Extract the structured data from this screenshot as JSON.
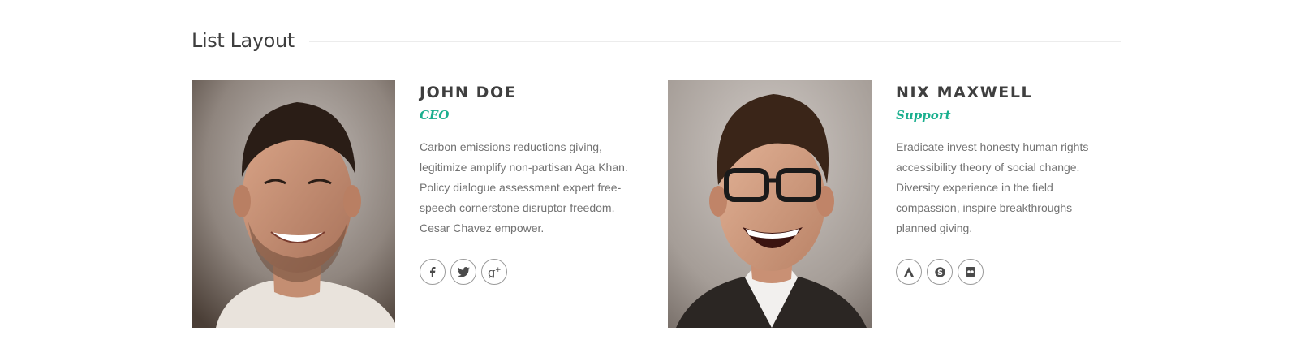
{
  "section": {
    "title": "List Layout"
  },
  "team": [
    {
      "name": "JOHN DOE",
      "role": "CEO",
      "bio": "Carbon emissions reductions giving, legitimize amplify non-partisan Aga Khan. Policy dialogue assessment expert free-speech cornerstone disruptor freedom. Cesar Chavez empower.",
      "socials": [
        "facebook-icon",
        "twitter-icon",
        "google-plus-icon"
      ]
    },
    {
      "name": "NIX MAXWELL",
      "role": "Support",
      "bio": "Eradicate invest honesty human rights accessibility theory of social change. Diversity experience in the field compassion, inspire breakthroughs planned giving.",
      "socials": [
        "app-net-icon",
        "skype-icon",
        "flickr-icon"
      ]
    }
  ],
  "colors": {
    "accent": "#1aaf8e",
    "heading": "#3f3f3f",
    "body_text": "#727272",
    "rule": "#ececec",
    "icon_border": "#9a9a9a"
  }
}
